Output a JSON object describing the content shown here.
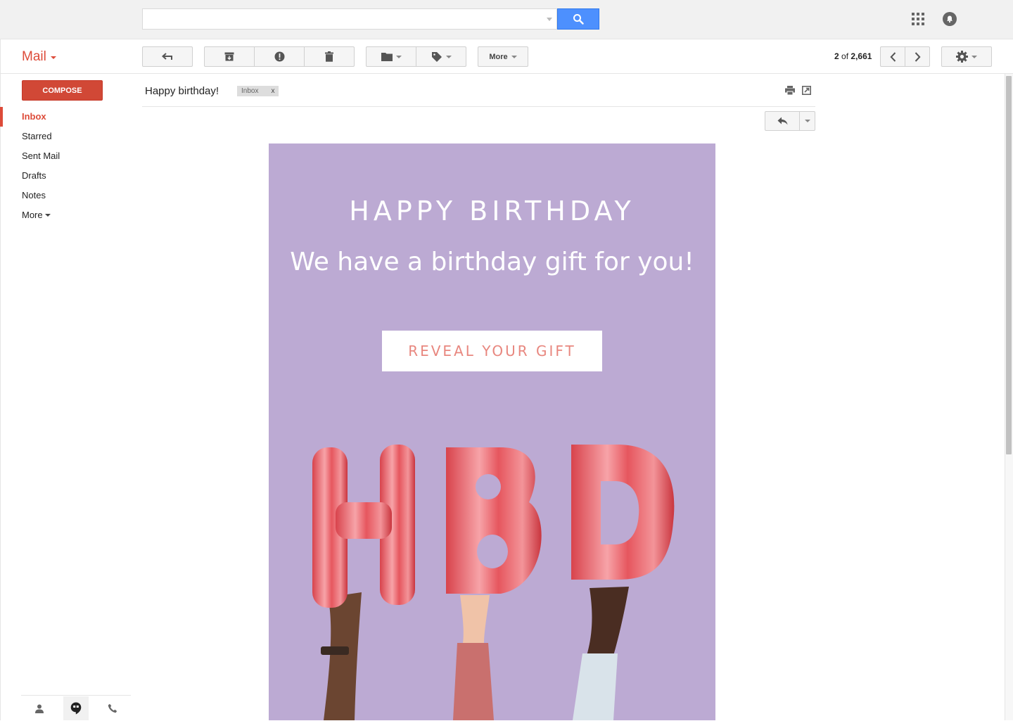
{
  "search": {
    "value": "",
    "placeholder": ""
  },
  "app": {
    "title": "Mail"
  },
  "toolbar": {
    "more_label": "More",
    "pager_current": "2",
    "pager_of": "of",
    "pager_total": "2,661"
  },
  "compose_label": "COMPOSE",
  "sidebar": {
    "items": [
      {
        "label": "Inbox",
        "active": true
      },
      {
        "label": "Starred"
      },
      {
        "label": "Sent Mail"
      },
      {
        "label": "Drafts"
      },
      {
        "label": "Notes"
      }
    ],
    "more_label": "More"
  },
  "message": {
    "subject": "Happy birthday!",
    "label_chip": "Inbox",
    "label_remove": "x"
  },
  "email_body": {
    "heading": "HAPPY BIRTHDAY",
    "subheading": "We have a birthday gift for you!",
    "cta_label": "REVEAL YOUR GIFT",
    "balloon_letters": [
      "H",
      "B",
      "D"
    ],
    "background_color": "#bcaad3",
    "cta_text_color": "#e8877f",
    "balloon_color": "#e9646a"
  },
  "colors": {
    "brand_red": "#dd4b39",
    "compose_red": "#d14836",
    "search_blue": "#4d90fe"
  },
  "icons": {
    "search": "search-icon",
    "apps": "apps-grid-icon",
    "notifications": "notifications-icon",
    "back": "back-arrow-icon",
    "archive": "archive-icon",
    "spam": "report-spam-icon",
    "delete": "trash-icon",
    "move": "folder-icon",
    "labels": "label-tag-icon",
    "prev": "chevron-left-icon",
    "next": "chevron-right-icon",
    "settings": "gear-icon",
    "print": "print-icon",
    "new_window": "new-window-icon",
    "reply": "reply-icon",
    "contacts": "person-icon",
    "hangouts": "hangouts-icon",
    "phone": "phone-icon"
  }
}
